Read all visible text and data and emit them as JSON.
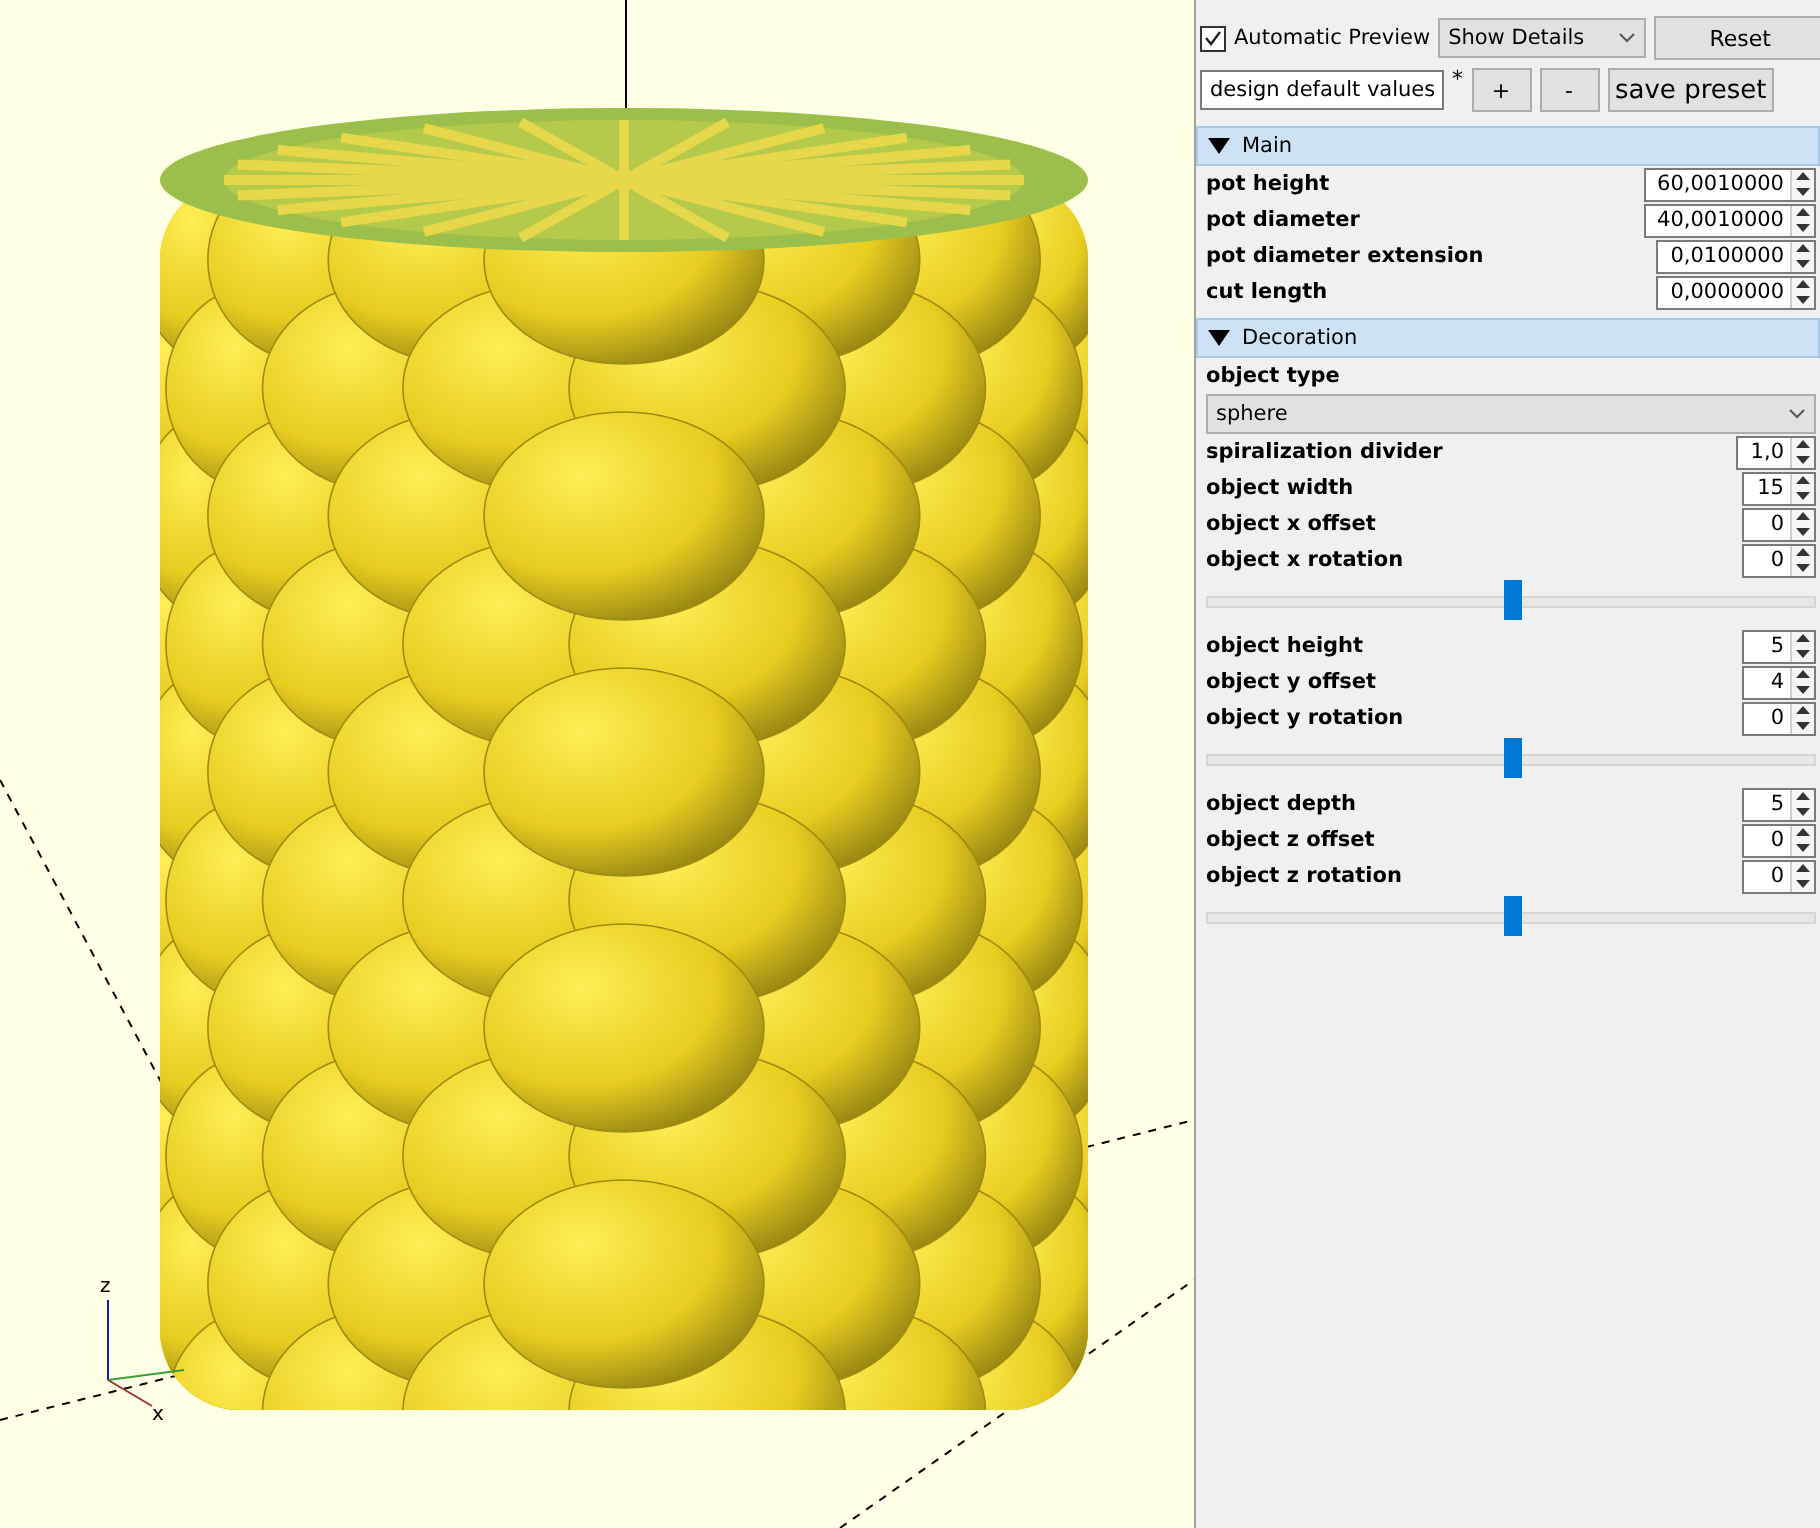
{
  "viewport": {
    "axis_labels": [
      "z",
      "x"
    ]
  },
  "toolbar": {
    "automatic_preview": {
      "label": "Automatic Preview",
      "checked": true
    },
    "details": {
      "value": "Show Details"
    },
    "reset": "Reset"
  },
  "presets": {
    "value": "design default values",
    "modified": "*",
    "buttons": [
      "+",
      "-"
    ],
    "save": "save preset"
  },
  "groups": [
    {
      "title": "Main",
      "expanded": true,
      "params": [
        {
          "kind": "number",
          "label": "pot height",
          "value": "60,0010000"
        },
        {
          "kind": "number",
          "label": "pot diameter",
          "value": "40,0010000"
        },
        {
          "kind": "number",
          "label": "pot diameter extension",
          "value": "0,0100000"
        },
        {
          "kind": "number",
          "label": "cut length",
          "value": "0,0000000"
        }
      ]
    },
    {
      "title": "Decoration",
      "expanded": true,
      "params": [
        {
          "kind": "dropdown",
          "label": "object type",
          "value": "sphere"
        },
        {
          "kind": "number",
          "label": "spiralization divider",
          "value": "1,0"
        },
        {
          "kind": "number",
          "label": "object width",
          "value": "15"
        },
        {
          "kind": "number",
          "label": "object x offset",
          "value": "0"
        },
        {
          "kind": "number",
          "label": "object x rotation",
          "value": "0"
        },
        {
          "kind": "slider",
          "level": 0.5
        },
        {
          "kind": "number",
          "label": "object height",
          "value": "5"
        },
        {
          "kind": "number",
          "label": "object y offset",
          "value": "4"
        },
        {
          "kind": "number",
          "label": "object y rotation",
          "value": "0"
        },
        {
          "kind": "slider",
          "level": 0.5
        },
        {
          "kind": "number",
          "label": "object depth",
          "value": "5"
        },
        {
          "kind": "number",
          "label": "object z offset",
          "value": "0"
        },
        {
          "kind": "number",
          "label": "object z rotation",
          "value": "0"
        },
        {
          "kind": "slider",
          "level": 0.5
        }
      ]
    }
  ]
}
